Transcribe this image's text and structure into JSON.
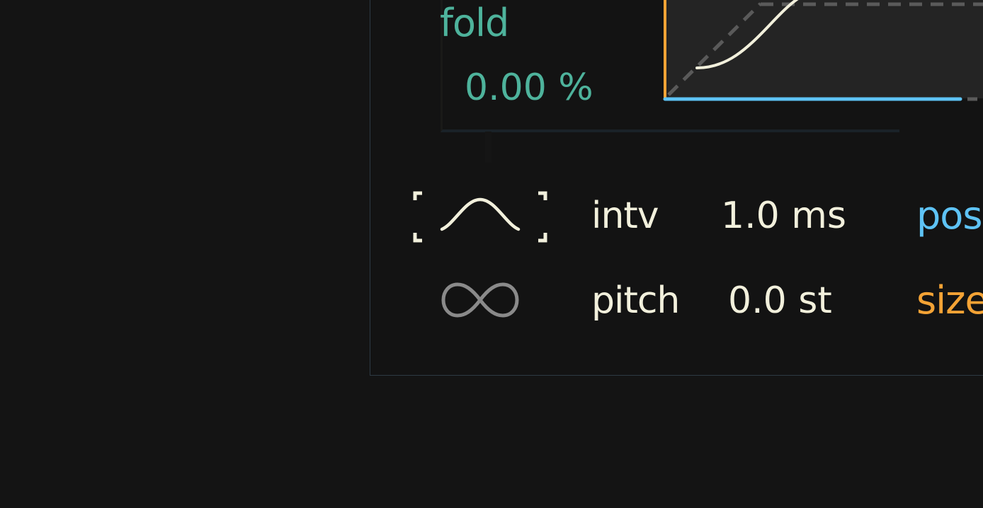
{
  "fold": {
    "label": "fold",
    "value": "0.00 %",
    "color": "#4eb39c"
  },
  "curve": {
    "axis_x_color": "#5ec3f5",
    "axis_y_color": "#f4a335",
    "curve_color": "#f2f0dc",
    "guide_color": "#5a5a5a",
    "background": "#242424"
  },
  "params": {
    "intv": {
      "name": "intv",
      "value": "1.0 ms"
    },
    "pitch": {
      "name": "pitch",
      "value": "0.0 st"
    }
  },
  "side_labels": {
    "pos": {
      "label": "pos",
      "color": "#5ec3f5"
    },
    "size": {
      "label": "size",
      "color": "#f4a335"
    }
  },
  "icons": {
    "window_shape": "hann-window-icon",
    "loop": "infinity-loop-icon"
  }
}
